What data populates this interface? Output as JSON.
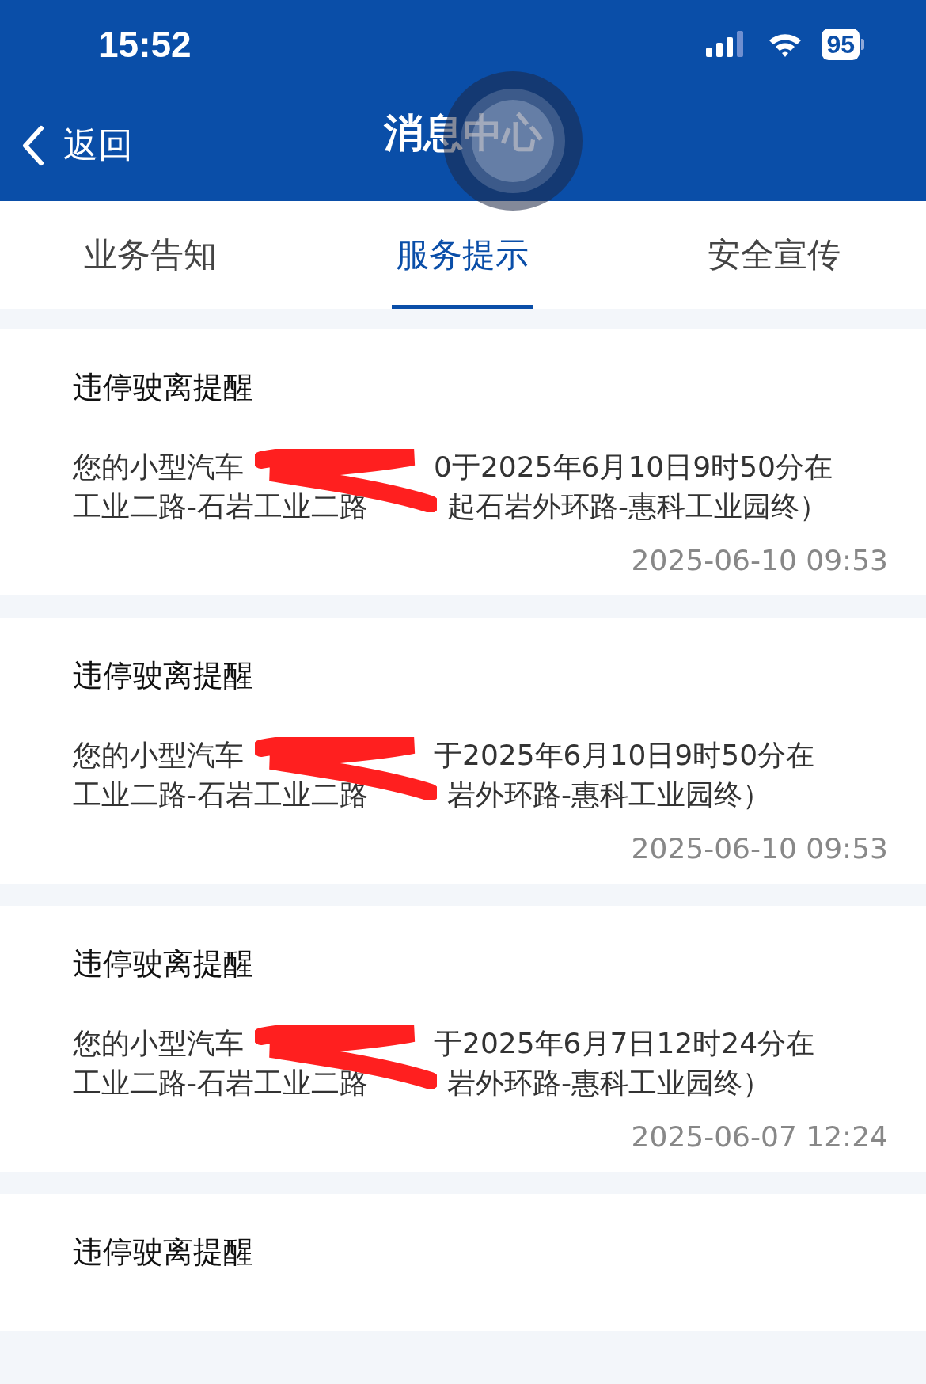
{
  "status_bar": {
    "time": "15:52",
    "battery": "95"
  },
  "nav": {
    "back": "返回",
    "title": "消息中心"
  },
  "tabs": [
    {
      "label": "业务告知",
      "selected": false
    },
    {
      "label": "服务提示",
      "selected": true
    },
    {
      "label": "安全宣传",
      "selected": false
    }
  ],
  "messages": [
    {
      "title": "违停驶离提醒",
      "line_1": [
        "您的小型汽车",
        "0于2025年6月10日9时50分在"
      ],
      "line_2": [
        "工业二路-石岩工业二路",
        "起石岩外环路-惠科工业园终）"
      ],
      "time": "2025-06-10 09:53"
    },
    {
      "title": "违停驶离提醒",
      "line_1": [
        "您的小型汽车",
        "于2025年6月10日9时50分在"
      ],
      "line_2": [
        "工业二路-石岩工业二路",
        "岩外环路-惠科工业园终）"
      ],
      "time": "2025-06-10 09:53"
    },
    {
      "title": "违停驶离提醒",
      "line_1": [
        "您的小型汽车",
        "于2025年6月7日12时24分在"
      ],
      "line_2": [
        "工业二路-石岩工业二路",
        "岩外环路-惠科工业园终）"
      ],
      "time": "2025-06-07 12:24"
    },
    {
      "title": "违停驶离提醒"
    }
  ]
}
